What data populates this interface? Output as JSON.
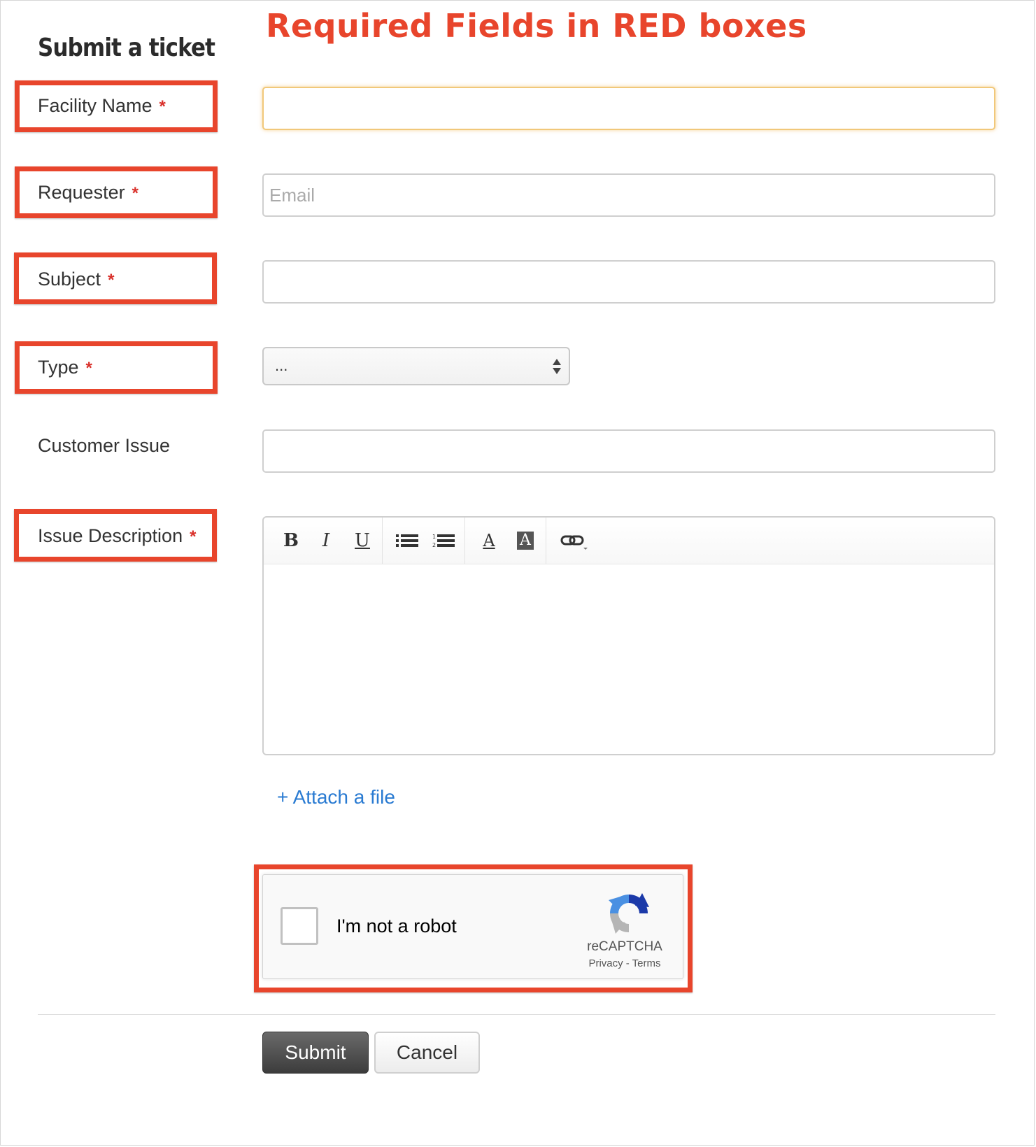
{
  "annotation": "Required Fields in RED boxes",
  "form": {
    "title": "Submit a ticket",
    "required_marker": "*",
    "fields": {
      "facility_name": {
        "label": "Facility Name",
        "value": "",
        "required": true,
        "focused": true
      },
      "requester": {
        "label": "Requester",
        "placeholder": "Email",
        "value": "",
        "required": true
      },
      "subject": {
        "label": "Subject",
        "value": "",
        "required": true
      },
      "type": {
        "label": "Type",
        "selected": "...",
        "required": true
      },
      "customer_issue": {
        "label": "Customer Issue",
        "value": "",
        "required": false
      },
      "issue_description": {
        "label": "Issue Description",
        "value": "",
        "required": true
      }
    },
    "editor_toolbar": {
      "bold": "B",
      "italic": "I",
      "underline": "U",
      "bulleted_list": "bulleted-list-icon",
      "numbered_list": "numbered-list-icon",
      "font_color": "A",
      "background_color": "A",
      "link": "link-icon"
    },
    "attach_link": "+ Attach a file",
    "captcha": {
      "label": "I'm not a robot",
      "brand": "reCAPTCHA",
      "links": "Privacy - Terms",
      "checked": false
    },
    "buttons": {
      "submit": "Submit",
      "cancel": "Cancel"
    }
  },
  "colors": {
    "annotation_red": "#e8452c",
    "required_star": "#d9302a",
    "link_blue": "#2a7bd2",
    "focus_glow": "#f1c87a"
  }
}
